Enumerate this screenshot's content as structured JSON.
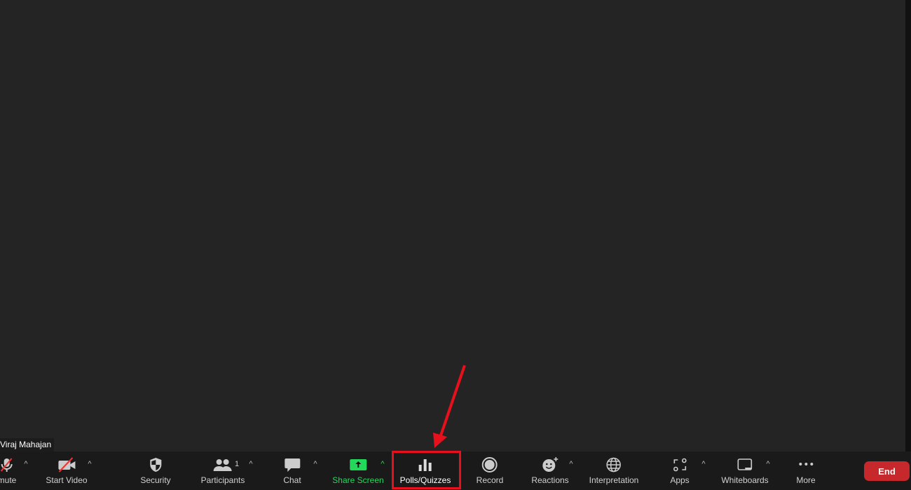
{
  "participant_name": "Viraj Mahajan",
  "toolbar": {
    "mute": "mute",
    "start_video": "Start Video",
    "security": "Security",
    "participants": "Participants",
    "participant_count": "1",
    "chat": "Chat",
    "share_screen": "Share Screen",
    "polls": "Polls/Quizzes",
    "record": "Record",
    "reactions": "Reactions",
    "interpretation": "Interpretation",
    "apps": "Apps",
    "whiteboards": "Whiteboards",
    "more": "More",
    "end": "End",
    "caret": "^"
  },
  "colors": {
    "share_green": "#23d959",
    "end_red": "#c6282b",
    "highlight": "#e8101c"
  }
}
